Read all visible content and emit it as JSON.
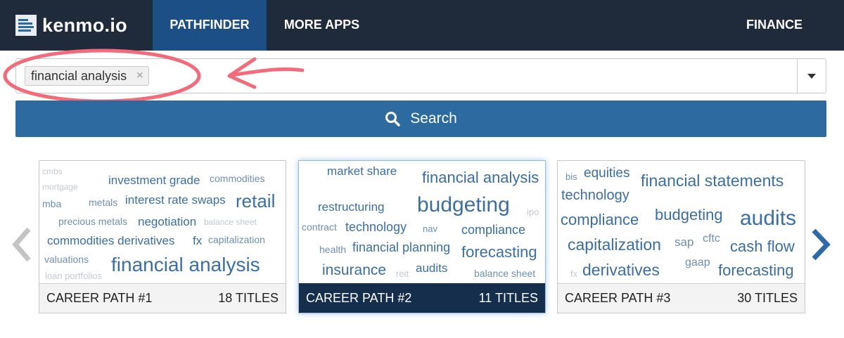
{
  "brand": {
    "name": "kenmo.io"
  },
  "nav": {
    "pathfinder": "PATHFINDER",
    "more_apps": "MORE APPS",
    "finance": "FINANCE"
  },
  "search": {
    "tag": "financial analysis",
    "tag_remove": "×",
    "button_label": "Search"
  },
  "cards": [
    {
      "title": "CAREER PATH #1",
      "count": "18 TITLES",
      "words": [
        "cmbs",
        "mortgage",
        "investment grade",
        "commodities",
        "metals",
        "interest rate swaps",
        "retail",
        "mba",
        "precious metals",
        "negotiation",
        "balance sheet",
        "commodities derivatives",
        "fx",
        "capitalization",
        "valuations",
        "financial analysis",
        "loan portfolios"
      ]
    },
    {
      "title": "CAREER PATH #2",
      "count": "11 TITLES",
      "words": [
        "market share",
        "financial analysis",
        "restructuring",
        "budgeting",
        "ipo",
        "contract",
        "technology",
        "nav",
        "compliance",
        "health",
        "financial planning",
        "forecasting",
        "insurance",
        "reit",
        "audits",
        "balance sheet"
      ]
    },
    {
      "title": "CAREER PATH #3",
      "count": "30 TITLES",
      "words": [
        "bis",
        "equities",
        "financial statements",
        "technology",
        "compliance",
        "budgeting",
        "audits",
        "capitalization",
        "sap",
        "cftc",
        "cash flow",
        "gaap",
        "fx",
        "derivatives",
        "forecasting"
      ]
    }
  ],
  "colors": {
    "nav_bg": "#1f2a3a",
    "nav_active": "#1b4f86",
    "button": "#2d6a9f",
    "word": "#3b6ea3",
    "selected_footer": "#142e4c",
    "annotation": "#f26b7a"
  },
  "icons": {
    "search": "search-icon",
    "prev": "chevron-left-icon",
    "next": "chevron-right-icon",
    "remove": "close-icon",
    "dropdown": "caret-down-icon"
  }
}
